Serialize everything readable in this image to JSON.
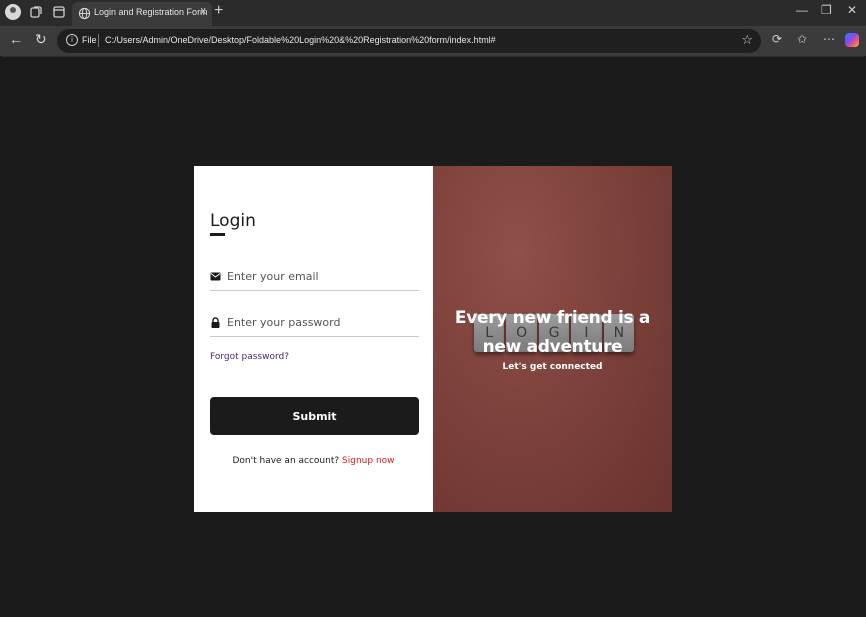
{
  "browser": {
    "tab_title": "Login and Registration Form",
    "close_tab": "x",
    "new_tab": "+",
    "address_scheme": "File",
    "address_url": "C:/Users/Admin/OneDrive/Desktop/Foldable%20Login%20&%20Registration%20form/index.html#",
    "window_controls": [
      "—",
      "❐",
      "✕"
    ]
  },
  "form": {
    "title": "Login",
    "email_placeholder": "Enter your email",
    "password_placeholder": "Enter your password",
    "forgot_label": "Forgot password?",
    "submit_label": "Submit",
    "signup_prompt": "Don't have an account?",
    "signup_link": "Signup now"
  },
  "hero": {
    "tiles": [
      "L",
      "O",
      "G",
      "I",
      "N"
    ],
    "headline_line1": "Every new friend is a",
    "headline_line2": "new adventure",
    "subline": "Let's get connected"
  },
  "colors": {
    "page_bg": "#1b1b1b",
    "submit_bg": "#1b1b1b",
    "signup_link": "#d11a1a",
    "forgot_link": "#4b2772",
    "hero_bg": "#7a3f39"
  },
  "icons": {
    "email": "envelope-icon",
    "password": "lock-icon"
  }
}
